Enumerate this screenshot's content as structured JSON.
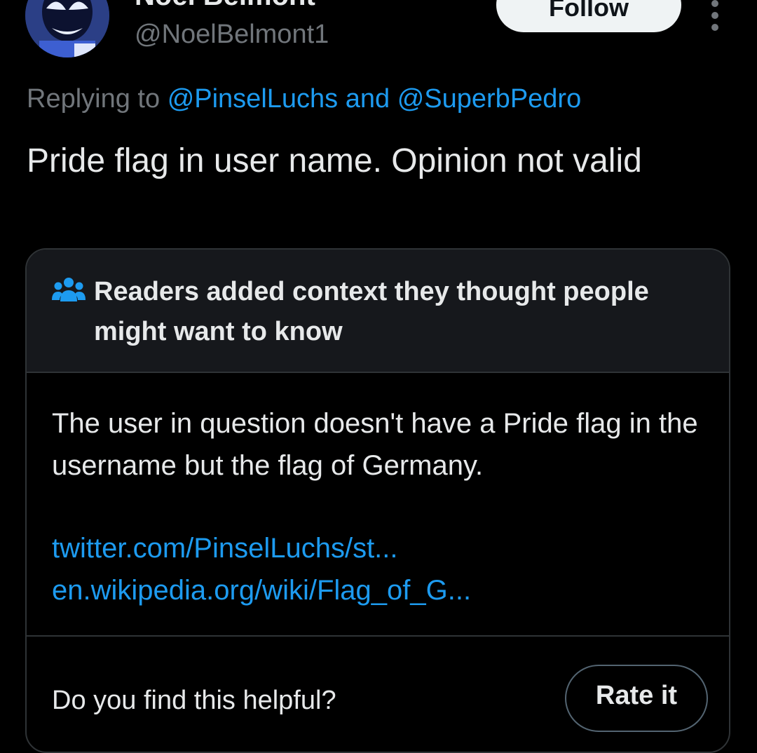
{
  "author": {
    "display_name": "Noel Belmont",
    "handle": "@NoelBelmont1",
    "avatar_icon": "avatar-venom-image"
  },
  "actions": {
    "follow_label": "Follow",
    "more_icon": "more-dots-icon"
  },
  "reply_context": {
    "prefix": "Replying to",
    "mention_1": "@PinselLuchs",
    "joiner": "and",
    "mention_2": "@SuperbPedro"
  },
  "tweet": {
    "text": "Pride flag in user name. Opinion not valid"
  },
  "community_note": {
    "icon": "people-icon",
    "title": "Readers added context they thought people might want to know",
    "body": "The user in question doesn't have a Pride flag in the username but the flag of Germany.",
    "links": [
      "twitter.com/PinselLuchs/st...",
      "en.wikipedia.org/wiki/Flag_of_G..."
    ],
    "helpful_question": "Do you find this helpful?",
    "rate_label": "Rate it"
  },
  "colors": {
    "background": "#000000",
    "text": "#e7e9ea",
    "muted": "#71767b",
    "link": "#1d9bf0",
    "card_header": "#16181c",
    "border": "#2f3336"
  }
}
